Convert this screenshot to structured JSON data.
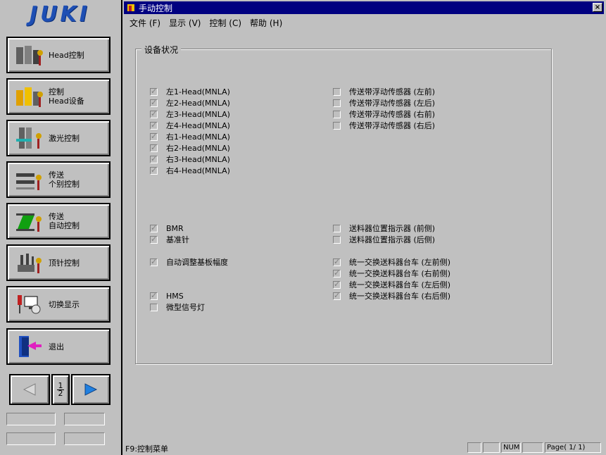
{
  "logo": "JUKI",
  "left_menu": [
    {
      "label": "Head控制"
    },
    {
      "label": "控制\nHead设备"
    },
    {
      "label": "激光控制"
    },
    {
      "label": "传送\n个别控制"
    },
    {
      "label": "传送\n自动控制"
    },
    {
      "label": "顶针控制"
    },
    {
      "label": "切换显示"
    },
    {
      "label": "退出"
    }
  ],
  "nav": {
    "page_indicator_num": "1",
    "page_indicator_den": "2"
  },
  "window": {
    "title": "手动控制",
    "close_label": "×",
    "menus": [
      "文件 (F)",
      "显示 (V)",
      "控制 (C)",
      "帮助 (H)"
    ]
  },
  "groupbox": {
    "title": "设备状况"
  },
  "checkboxes_left": [
    {
      "label": "左1-Head(MNLA)",
      "checked": true
    },
    {
      "label": "左2-Head(MNLA)",
      "checked": true
    },
    {
      "label": "左3-Head(MNLA)",
      "checked": true
    },
    {
      "label": "左4-Head(MNLA)",
      "checked": true
    },
    {
      "label": "右1-Head(MNLA)",
      "checked": true
    },
    {
      "label": "右2-Head(MNLA)",
      "checked": true
    },
    {
      "label": "右3-Head(MNLA)",
      "checked": true
    },
    {
      "label": "右4-Head(MNLA)",
      "checked": true
    },
    {
      "label": "BMR",
      "checked": true
    },
    {
      "label": "基准针",
      "checked": true
    },
    {
      "label": "自动调整基板幅度",
      "checked": true
    },
    {
      "label": "HMS",
      "checked": true
    },
    {
      "label": "微型信号灯",
      "checked": false
    }
  ],
  "checkboxes_right": [
    {
      "label": "传送带浮动传感器 (左前)",
      "checked": false
    },
    {
      "label": "传送带浮动传感器 (左后)",
      "checked": false
    },
    {
      "label": "传送带浮动传感器 (右前)",
      "checked": false
    },
    {
      "label": "传送带浮动传感器 (右后)",
      "checked": false
    },
    {
      "label": "送料器位置指示器 (前侧)",
      "checked": false
    },
    {
      "label": "送料器位置指示器 (后侧)",
      "checked": false
    },
    {
      "label": "统一交换送料器台车 (左前侧)",
      "checked": true
    },
    {
      "label": "统一交换送料器台车 (右前侧)",
      "checked": true
    },
    {
      "label": "统一交换送料器台车 (左后侧)",
      "checked": true
    },
    {
      "label": "统一交换送料器台车 (右后侧)",
      "checked": true
    }
  ],
  "status_bar": {
    "hint": "F9:控制菜单",
    "num": "NUM",
    "page": "Page( 1/ 1)"
  }
}
